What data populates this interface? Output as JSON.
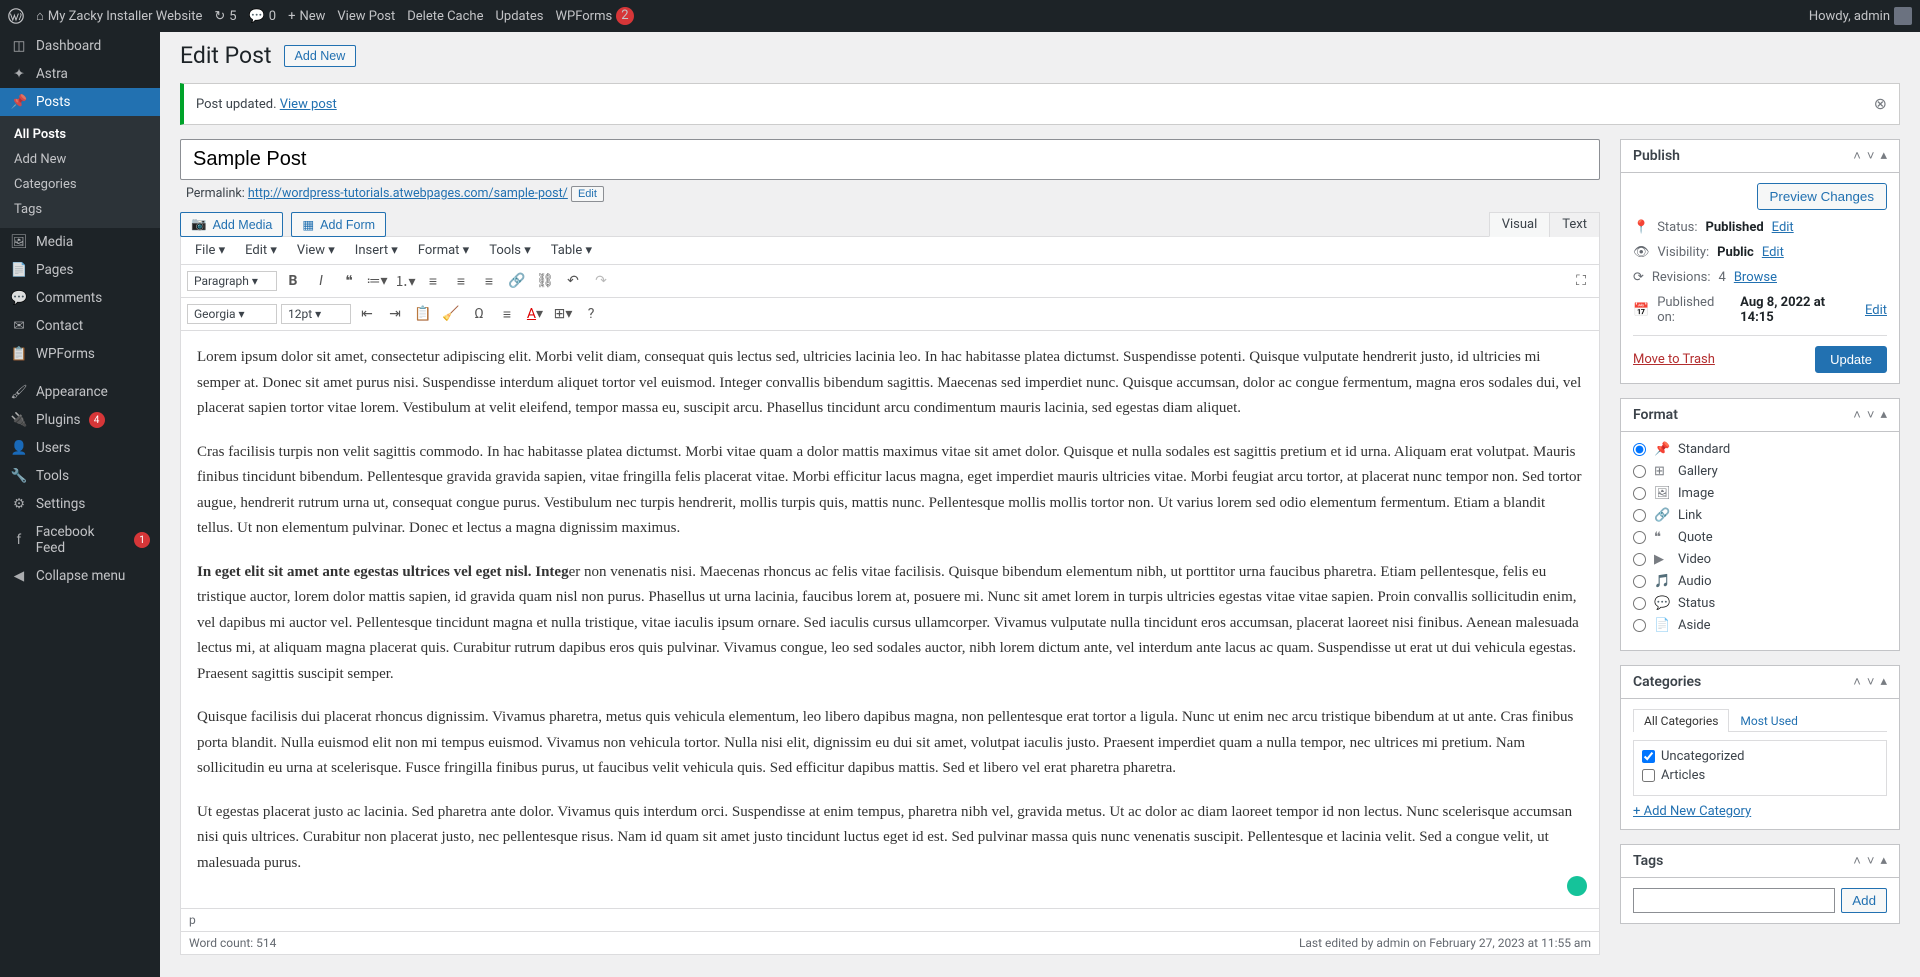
{
  "toolbar": {
    "site_name": "My Zacky Installer Website",
    "refresh_count": "5",
    "comments_count": "0",
    "new_label": "New",
    "view_post": "View Post",
    "delete_cache": "Delete Cache",
    "updates": "Updates",
    "wpforms": "WPForms",
    "wpforms_badge": "2",
    "howdy": "Howdy, admin"
  },
  "sidebar": {
    "dashboard": "Dashboard",
    "astra": "Astra",
    "posts": "Posts",
    "posts_sub": {
      "all": "All Posts",
      "add": "Add New",
      "categories": "Categories",
      "tags": "Tags"
    },
    "media": "Media",
    "pages": "Pages",
    "comments": "Comments",
    "contact": "Contact",
    "wpforms": "WPForms",
    "appearance": "Appearance",
    "plugins": "Plugins",
    "plugins_badge": "4",
    "users": "Users",
    "tools": "Tools",
    "settings": "Settings",
    "facebook": "Facebook Feed",
    "facebook_badge": "1",
    "collapse": "Collapse menu"
  },
  "page": {
    "title": "Edit Post",
    "add_new": "Add New"
  },
  "notice": {
    "text": "Post updated. ",
    "link": "View post"
  },
  "post": {
    "title": "Sample Post",
    "permalink_label": "Permalink:",
    "permalink_url": "http://wordpress-tutorials.atwebpages.com/sample-post/",
    "edit_btn": "Edit"
  },
  "editor": {
    "add_media": "Add Media",
    "add_form": "Add Form",
    "tab_visual": "Visual",
    "tab_text": "Text",
    "menu": {
      "file": "File",
      "edit": "Edit",
      "view": "View",
      "insert": "Insert",
      "format": "Format",
      "tools": "Tools",
      "table": "Table"
    },
    "paragraph_sel": "Paragraph",
    "font_sel": "Georgia",
    "size_sel": "12pt",
    "content": {
      "p1": "Lorem ipsum dolor sit amet, consectetur adipiscing elit. Morbi velit diam, consequat quis lectus sed, ultricies lacinia leo. In hac habitasse platea dictumst. Suspendisse potenti. Quisque vulputate hendrerit justo, id ultricies mi semper at. Donec sit amet purus nisi. Suspendisse interdum aliquet tortor vel euismod. Integer convallis bibendum sagittis. Maecenas sed imperdiet nunc. Quisque accumsan, dolor ac congue fermentum, magna eros sodales dui, vel placerat sapien tortor vitae lorem. Vestibulum at velit eleifend, tempor massa eu, suscipit arcu. Phasellus tincidunt arcu condimentum mauris lacinia, sed egestas diam aliquet.",
      "p2": "Cras facilisis turpis non velit sagittis commodo. In hac habitasse platea dictumst. Morbi vitae quam a dolor mattis maximus vitae sit amet dolor. Quisque et nulla sodales est sagittis pretium et id urna. Aliquam erat volutpat. Mauris finibus tincidunt bibendum. Pellentesque gravida gravida sapien, vitae fringilla felis placerat vitae. Morbi efficitur lacus magna, eget imperdiet mauris ultricies vitae. Morbi feugiat arcu tortor, at placerat nunc tempor non. Sed tortor augue, hendrerit rutrum urna ut, consequat congue purus. Vestibulum nec turpis hendrerit, mollis turpis quis, mattis nunc. Pellentesque mollis mollis tortor non. Ut varius lorem sed odio elementum fermentum. Etiam a blandit tellus. Ut non elementum pulvinar. Donec et lectus a magna dignissim maximus.",
      "p3a": "In eget elit sit amet ante egestas ultrices vel eget nisl. Integ",
      "p3b": "er non venenatis nisi. Maecenas rhoncus ac felis vitae facilisis. Quisque bibendum elementum nibh, ut porttitor urna faucibus pharetra. Etiam pellentesque, felis eu tristique auctor, lorem dolor mattis sapien, id gravida quam nisl non purus. Phasellus ut urna lacinia, faucibus lorem at, posuere mi. Nunc sit amet lorem in turpis ultricies egestas vitae vitae sapien. Proin convallis sollicitudin enim, vel dapibus mi auctor vel. Pellentesque tincidunt magna et nulla tristique, vitae iaculis ipsum ornare. Sed iaculis cursus ullamcorper. Vivamus vulputate nulla tincidunt eros accumsan, placerat laoreet nisi finibus. Aenean malesuada lectus mi, at aliquam magna placerat quis. Curabitur rutrum dapibus eros quis pulvinar. Vivamus congue, leo sed sodales auctor, nibh lorem dictum ante, vel interdum ante lacus ac quam. Suspendisse ut erat ut dui vehicula egestas. Praesent sagittis suscipit semper.",
      "p4": "Quisque facilisis dui placerat rhoncus dignissim. Vivamus pharetra, metus quis vehicula elementum, leo libero dapibus magna, non pellentesque erat tortor a ligula. Nunc ut enim nec arcu tristique bibendum at ut ante. Cras finibus porta blandit. Nulla euismod elit non mi tempus euismod. Vivamus non vehicula tortor. Nulla nisi elit, dignissim eu dui sit amet, volutpat iaculis justo. Praesent imperdiet quam a nulla tempor, nec ultrices mi pretium. Nam sollicitudin eu urna at scelerisque. Fusce fringilla finibus purus, ut faucibus velit vehicula quis. Sed efficitur dapibus mattis. Sed et libero vel erat pharetra pharetra.",
      "p5": "Ut egestas placerat justo ac lacinia. Sed pharetra ante dolor. Vivamus quis interdum orci. Suspendisse at enim tempus, pharetra nibh vel, gravida metus. Ut ac dolor ac diam laoreet tempor id non lectus. Nunc scelerisque accumsan nisi quis ultrices. Curabitur non placerat justo, nec pellentesque risus. Nam id quam sit amet justo tincidunt luctus eget id est. Sed pulvinar massa quis nunc venenatis suscipit. Pellentesque et lacinia velit. Sed a congue velit, ut malesuada purus."
    },
    "path": "p",
    "wordcount": "Word count: 514",
    "lastedit": "Last edited by admin on February 27, 2023 at 11:55 am"
  },
  "publish": {
    "title": "Publish",
    "preview": "Preview Changes",
    "status_label": "Status:",
    "status_value": "Published",
    "status_edit": "Edit",
    "visibility_label": "Visibility:",
    "visibility_value": "Public",
    "visibility_edit": "Edit",
    "revisions_label": "Revisions:",
    "revisions_value": "4",
    "revisions_browse": "Browse",
    "published_label": "Published on:",
    "published_value": "Aug 8, 2022 at 14:15",
    "published_edit": "Edit",
    "trash": "Move to Trash",
    "update": "Update"
  },
  "format": {
    "title": "Format",
    "items": [
      "Standard",
      "Gallery",
      "Image",
      "Link",
      "Quote",
      "Video",
      "Audio",
      "Status",
      "Aside"
    ]
  },
  "categories": {
    "title": "Categories",
    "tab_all": "All Categories",
    "tab_used": "Most Used",
    "items": {
      "uncategorized": "Uncategorized",
      "articles": "Articles"
    },
    "add": "+ Add New Category"
  },
  "tags": {
    "title": "Tags",
    "add": "Add"
  }
}
